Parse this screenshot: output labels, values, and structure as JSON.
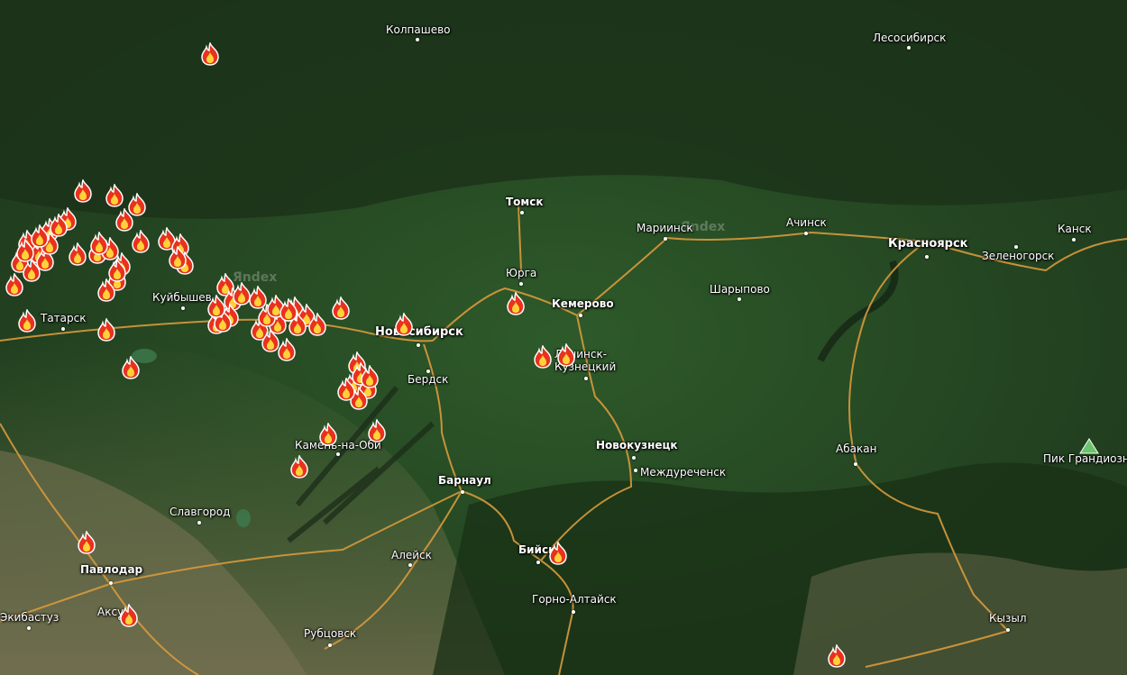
{
  "map": {
    "cities": [
      {
        "id": "kolpashevo",
        "name": "Колпашево",
        "major": false
      },
      {
        "id": "lesosibirsk",
        "name": "Лесосибирск",
        "major": false
      },
      {
        "id": "tomsk",
        "name": "Томск",
        "major": true
      },
      {
        "id": "mariinsk",
        "name": "Мариинск",
        "major": false
      },
      {
        "id": "achinsk",
        "name": "Ачинск",
        "major": false
      },
      {
        "id": "krasnoyarsk",
        "name": "Красноярск",
        "major": true
      },
      {
        "id": "zelenogorsk",
        "name": "Зеленогорск",
        "major": false
      },
      {
        "id": "kansk",
        "name": "Канск",
        "major": false
      },
      {
        "id": "yurga",
        "name": "Юрга",
        "major": false
      },
      {
        "id": "kemerovo",
        "name": "Кемерово",
        "major": true
      },
      {
        "id": "sharypovo",
        "name": "Шарыпово",
        "major": false
      },
      {
        "id": "kuybyshev",
        "name": "Куйбышев",
        "major": false
      },
      {
        "id": "tatarsk",
        "name": "Татарск",
        "major": false
      },
      {
        "id": "novosibirsk",
        "name": "Новосибирск",
        "major": true
      },
      {
        "id": "leninsk",
        "name": "Ленинск-\nКузнецкий",
        "major": false
      },
      {
        "id": "berdsk",
        "name": "Бердск",
        "major": false
      },
      {
        "id": "kamen",
        "name": "Камень-на-Оби",
        "major": false
      },
      {
        "id": "novokuznetsk",
        "name": "Новокузнецк",
        "major": true
      },
      {
        "id": "mezhdurechensk",
        "name": "Междуреченск",
        "major": false
      },
      {
        "id": "abakan",
        "name": "Абакан",
        "major": false
      },
      {
        "id": "barnaul",
        "name": "Барнаул",
        "major": true
      },
      {
        "id": "slavgorod",
        "name": "Славгород",
        "major": false
      },
      {
        "id": "pavlodar",
        "name": "Павлодар",
        "major": true
      },
      {
        "id": "biysk",
        "name": "Бийск",
        "major": true
      },
      {
        "id": "aleysk",
        "name": "Алейск",
        "major": false
      },
      {
        "id": "gorno-altaysk",
        "name": "Горно-Алтайск",
        "major": false
      },
      {
        "id": "ekibastuz",
        "name": "Экибастуз",
        "major": false
      },
      {
        "id": "aksu",
        "name": "Аксу",
        "major": false
      },
      {
        "id": "rubtsovsk",
        "name": "Рубцовск",
        "major": false
      },
      {
        "id": "kyzyl",
        "name": "Кызыл",
        "major": false
      }
    ],
    "peak": {
      "name": "Пик Грандиозный"
    },
    "watermark": "Яndex",
    "fire_count": 71,
    "colors": {
      "road": "#d89a3c",
      "fire_outer": "#e8321e",
      "fire_inner": "#ffd23a",
      "label": "#ffffff"
    }
  }
}
